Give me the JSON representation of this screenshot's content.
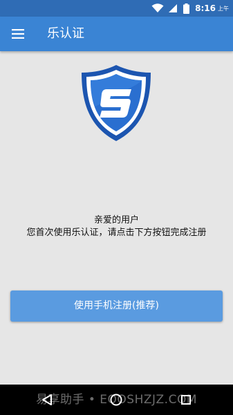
{
  "status_bar": {
    "time": "8:16",
    "ampm": "上午",
    "icons": [
      "wifi-icon",
      "signal-icon",
      "battery-icon"
    ]
  },
  "app_bar": {
    "title": "乐认证",
    "menu_icon": "hamburger-menu-icon"
  },
  "logo": {
    "icon": "shield-s-logo",
    "letter": "S",
    "colors": {
      "outer": "#1c55b0",
      "ring": "#ffffff",
      "inner": "#2a6fd0",
      "letter": "#ffffff"
    }
  },
  "message": {
    "line1": "亲爱的用户",
    "line2": "您首次使用乐认证，请点击下方按钮完成注册"
  },
  "register_button": {
    "label": "使用手机注册(推荐)"
  },
  "nav_bar": {
    "icons": [
      "back-icon",
      "home-icon",
      "recents-icon"
    ]
  },
  "watermark": {
    "text": "易享助手 • EOOSHZJZ.COM"
  },
  "colors": {
    "status_bar": "#2f6cb5",
    "app_bar": "#3a84d4",
    "background": "#e6e6e6",
    "button": "#5a9be0"
  }
}
